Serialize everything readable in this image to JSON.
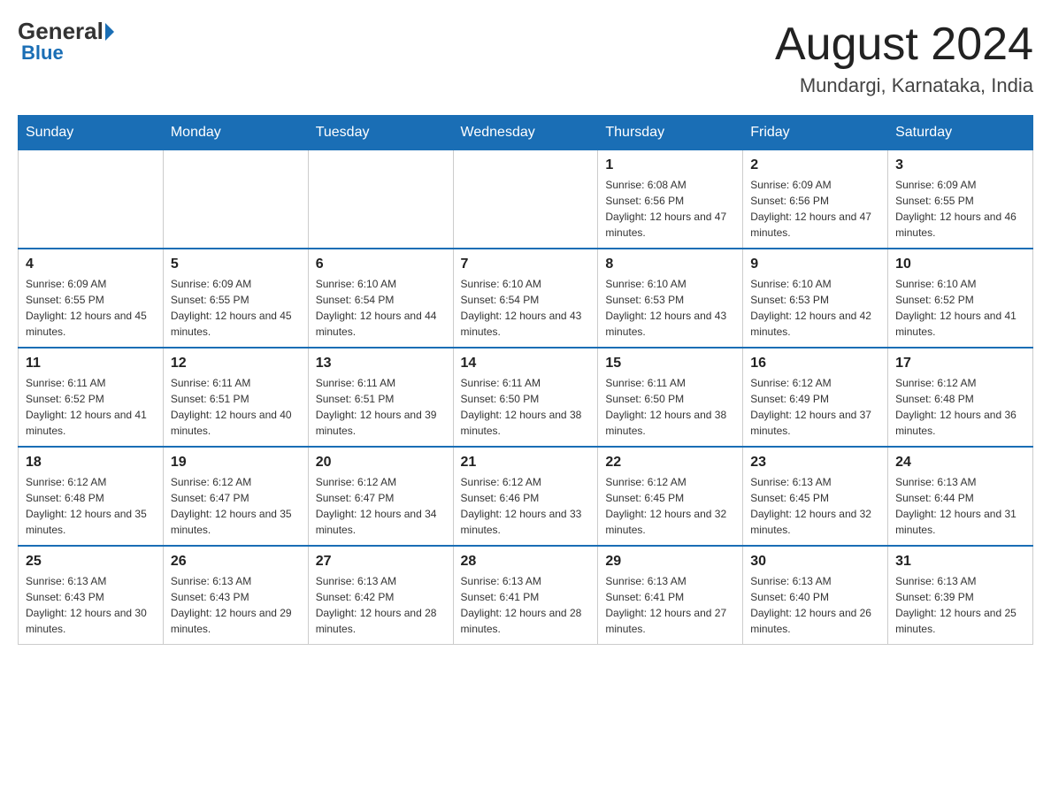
{
  "header": {
    "logo_general": "General",
    "logo_blue": "Blue",
    "month_year": "August 2024",
    "location": "Mundargi, Karnataka, India"
  },
  "days_of_week": [
    "Sunday",
    "Monday",
    "Tuesday",
    "Wednesday",
    "Thursday",
    "Friday",
    "Saturday"
  ],
  "weeks": [
    {
      "days": [
        {
          "number": "",
          "info": ""
        },
        {
          "number": "",
          "info": ""
        },
        {
          "number": "",
          "info": ""
        },
        {
          "number": "",
          "info": ""
        },
        {
          "number": "1",
          "info": "Sunrise: 6:08 AM\nSunset: 6:56 PM\nDaylight: 12 hours and 47 minutes."
        },
        {
          "number": "2",
          "info": "Sunrise: 6:09 AM\nSunset: 6:56 PM\nDaylight: 12 hours and 47 minutes."
        },
        {
          "number": "3",
          "info": "Sunrise: 6:09 AM\nSunset: 6:55 PM\nDaylight: 12 hours and 46 minutes."
        }
      ]
    },
    {
      "days": [
        {
          "number": "4",
          "info": "Sunrise: 6:09 AM\nSunset: 6:55 PM\nDaylight: 12 hours and 45 minutes."
        },
        {
          "number": "5",
          "info": "Sunrise: 6:09 AM\nSunset: 6:55 PM\nDaylight: 12 hours and 45 minutes."
        },
        {
          "number": "6",
          "info": "Sunrise: 6:10 AM\nSunset: 6:54 PM\nDaylight: 12 hours and 44 minutes."
        },
        {
          "number": "7",
          "info": "Sunrise: 6:10 AM\nSunset: 6:54 PM\nDaylight: 12 hours and 43 minutes."
        },
        {
          "number": "8",
          "info": "Sunrise: 6:10 AM\nSunset: 6:53 PM\nDaylight: 12 hours and 43 minutes."
        },
        {
          "number": "9",
          "info": "Sunrise: 6:10 AM\nSunset: 6:53 PM\nDaylight: 12 hours and 42 minutes."
        },
        {
          "number": "10",
          "info": "Sunrise: 6:10 AM\nSunset: 6:52 PM\nDaylight: 12 hours and 41 minutes."
        }
      ]
    },
    {
      "days": [
        {
          "number": "11",
          "info": "Sunrise: 6:11 AM\nSunset: 6:52 PM\nDaylight: 12 hours and 41 minutes."
        },
        {
          "number": "12",
          "info": "Sunrise: 6:11 AM\nSunset: 6:51 PM\nDaylight: 12 hours and 40 minutes."
        },
        {
          "number": "13",
          "info": "Sunrise: 6:11 AM\nSunset: 6:51 PM\nDaylight: 12 hours and 39 minutes."
        },
        {
          "number": "14",
          "info": "Sunrise: 6:11 AM\nSunset: 6:50 PM\nDaylight: 12 hours and 38 minutes."
        },
        {
          "number": "15",
          "info": "Sunrise: 6:11 AM\nSunset: 6:50 PM\nDaylight: 12 hours and 38 minutes."
        },
        {
          "number": "16",
          "info": "Sunrise: 6:12 AM\nSunset: 6:49 PM\nDaylight: 12 hours and 37 minutes."
        },
        {
          "number": "17",
          "info": "Sunrise: 6:12 AM\nSunset: 6:48 PM\nDaylight: 12 hours and 36 minutes."
        }
      ]
    },
    {
      "days": [
        {
          "number": "18",
          "info": "Sunrise: 6:12 AM\nSunset: 6:48 PM\nDaylight: 12 hours and 35 minutes."
        },
        {
          "number": "19",
          "info": "Sunrise: 6:12 AM\nSunset: 6:47 PM\nDaylight: 12 hours and 35 minutes."
        },
        {
          "number": "20",
          "info": "Sunrise: 6:12 AM\nSunset: 6:47 PM\nDaylight: 12 hours and 34 minutes."
        },
        {
          "number": "21",
          "info": "Sunrise: 6:12 AM\nSunset: 6:46 PM\nDaylight: 12 hours and 33 minutes."
        },
        {
          "number": "22",
          "info": "Sunrise: 6:12 AM\nSunset: 6:45 PM\nDaylight: 12 hours and 32 minutes."
        },
        {
          "number": "23",
          "info": "Sunrise: 6:13 AM\nSunset: 6:45 PM\nDaylight: 12 hours and 32 minutes."
        },
        {
          "number": "24",
          "info": "Sunrise: 6:13 AM\nSunset: 6:44 PM\nDaylight: 12 hours and 31 minutes."
        }
      ]
    },
    {
      "days": [
        {
          "number": "25",
          "info": "Sunrise: 6:13 AM\nSunset: 6:43 PM\nDaylight: 12 hours and 30 minutes."
        },
        {
          "number": "26",
          "info": "Sunrise: 6:13 AM\nSunset: 6:43 PM\nDaylight: 12 hours and 29 minutes."
        },
        {
          "number": "27",
          "info": "Sunrise: 6:13 AM\nSunset: 6:42 PM\nDaylight: 12 hours and 28 minutes."
        },
        {
          "number": "28",
          "info": "Sunrise: 6:13 AM\nSunset: 6:41 PM\nDaylight: 12 hours and 28 minutes."
        },
        {
          "number": "29",
          "info": "Sunrise: 6:13 AM\nSunset: 6:41 PM\nDaylight: 12 hours and 27 minutes."
        },
        {
          "number": "30",
          "info": "Sunrise: 6:13 AM\nSunset: 6:40 PM\nDaylight: 12 hours and 26 minutes."
        },
        {
          "number": "31",
          "info": "Sunrise: 6:13 AM\nSunset: 6:39 PM\nDaylight: 12 hours and 25 minutes."
        }
      ]
    }
  ]
}
